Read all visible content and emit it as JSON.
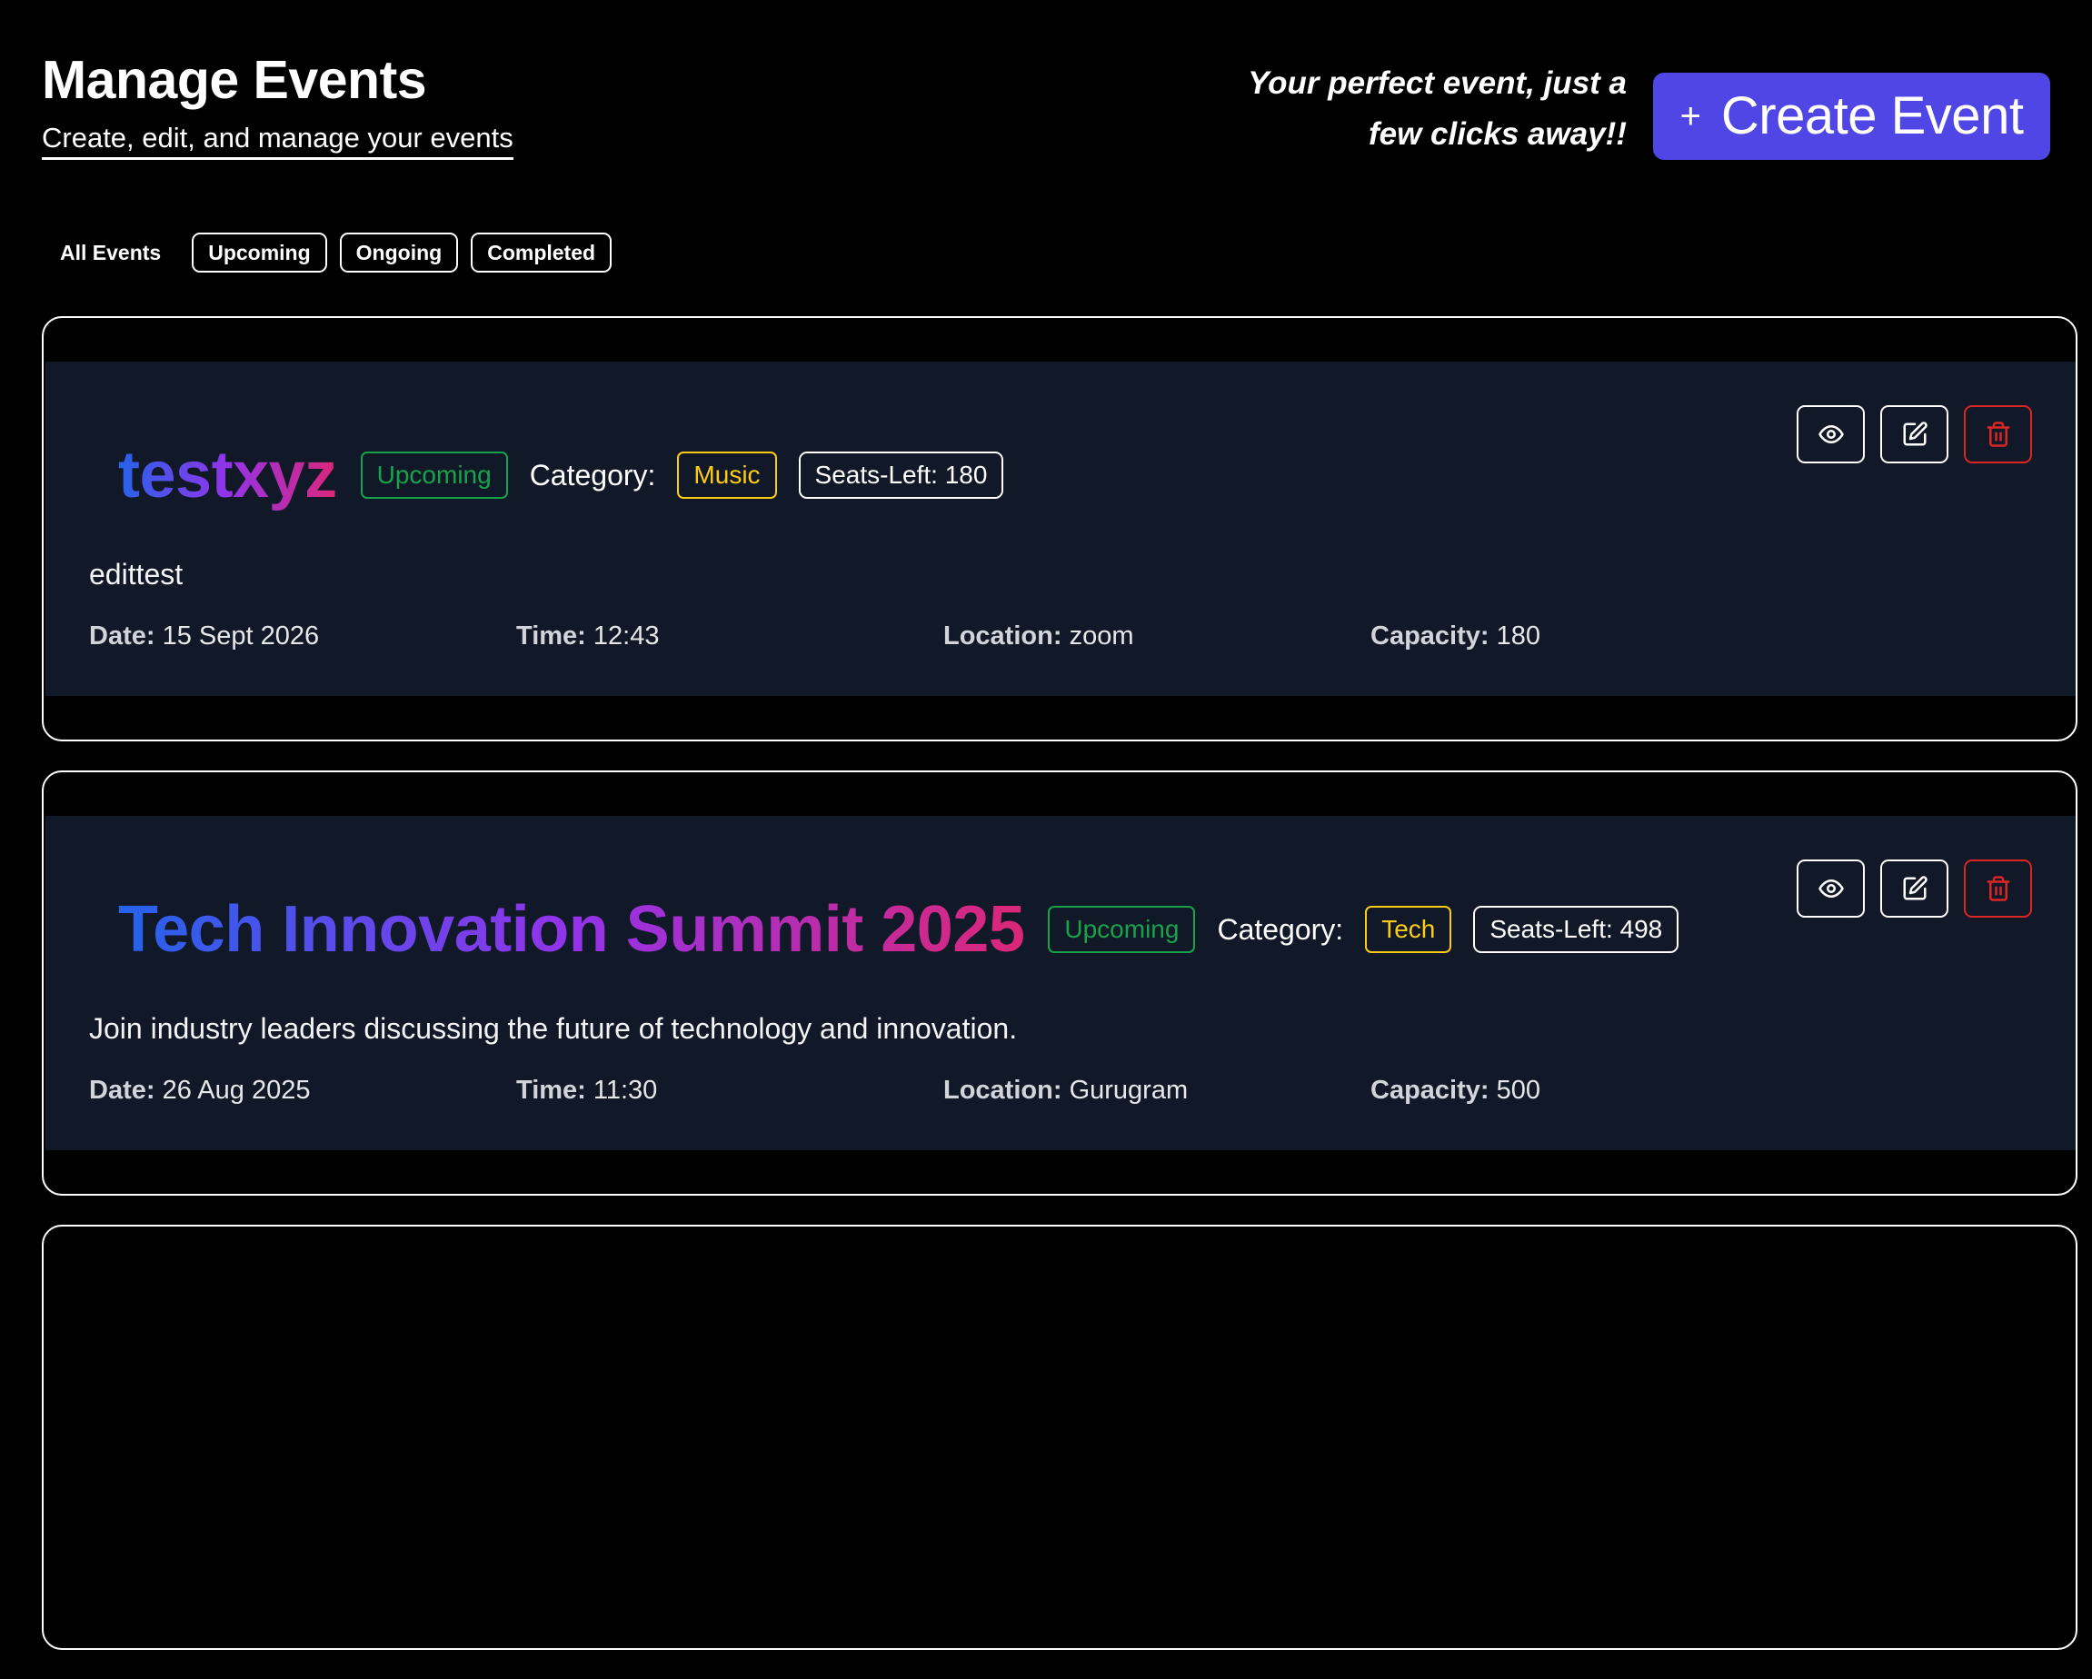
{
  "header": {
    "title": "Manage Events",
    "subtitle": "Create, edit, and manage your events",
    "tagline": "Your perfect event, just a few clicks away!!",
    "create_button": {
      "icon": "plus-icon",
      "label": "Create Event"
    }
  },
  "filters": [
    {
      "label": "All Events",
      "active": true
    },
    {
      "label": "Upcoming"
    },
    {
      "label": "Ongoing"
    },
    {
      "label": "Completed"
    }
  ],
  "colors": {
    "background": "#000000",
    "card_inner": "#111827",
    "accent": "#4f46e5",
    "status_green": "#16a34a",
    "category_yellow": "#facc15",
    "delete_red": "#dc2626",
    "title_gradient": [
      "#2563eb",
      "#9333ea",
      "#db2777"
    ]
  },
  "events": [
    {
      "title": "testxyz",
      "status": "Upcoming",
      "category_label": "Category:",
      "category": "Music",
      "seats": "Seats-Left: 180",
      "description": "edittest",
      "date_label": "Date:",
      "date": "15 Sept 2026",
      "time_label": "Time:",
      "time": "12:43",
      "location_label": "Location:",
      "location": "zoom",
      "capacity_label": "Capacity:",
      "capacity": "180",
      "actions": [
        "eye-icon",
        "edit-icon",
        "trash-icon"
      ]
    },
    {
      "title": "Tech Innovation Summit 2025",
      "status": "Upcoming",
      "category_label": "Category:",
      "category": "Tech",
      "seats": "Seats-Left: 498",
      "description": "Join industry leaders discussing the future of technology and innovation.",
      "date_label": "Date:",
      "date": "26 Aug 2025",
      "time_label": "Time:",
      "time": "11:30",
      "location_label": "Location:",
      "location": "Gurugram",
      "capacity_label": "Capacity:",
      "capacity": "500",
      "actions": [
        "eye-icon",
        "edit-icon",
        "trash-icon"
      ]
    }
  ]
}
